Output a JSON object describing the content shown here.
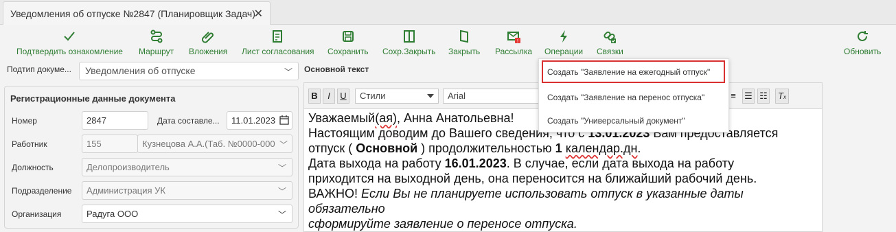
{
  "tab": {
    "title": "Уведомления об отпуске №2847 (Планировщик Задач)"
  },
  "toolbar": {
    "confirm": "Подтвердить ознакомление",
    "route": "Маршрут",
    "attachments": "Вложения",
    "approval_sheet": "Лист согласования",
    "save": "Сохранить",
    "save_close": "Сохр.Закрыть",
    "close": "Закрыть",
    "mailing": "Рассылка",
    "operations": "Операции",
    "links": "Связки",
    "refresh": "Обновить"
  },
  "form": {
    "subtype_label": "Подтип докуме...",
    "subtype_value": "Уведомления об отпуске",
    "reg_title": "Регистрационные данные документа",
    "number_label": "Номер",
    "number_value": "2847",
    "date_label": "Дата составле...",
    "date_value": "11.01.2023",
    "employee_label": "Работник",
    "employee_id": "155",
    "employee_name": "Кузнецова А.А.(Таб. №0000-000",
    "position_label": "Должность",
    "position_value": "Делопроизводитель",
    "department_label": "Подразделение",
    "department_value": "Администрация УК",
    "org_label": "Организация",
    "org_value": "Радуга ООО"
  },
  "editor": {
    "title": "Основной текст",
    "bold": "B",
    "italic": "I",
    "underline": "U",
    "styles": "Стили",
    "font": "Arial",
    "body": {
      "l1_a": "Уважаемый",
      "l1_b": "(ая)",
      "l1_c": ", Анна Анатольевна!",
      "l2_a": "Настоящим доводим до Вашего сведения, что с ",
      "l2_date": "13.01.2023",
      "l2_b": " Вам предоставляется",
      "l3_a": "отпуск ( ",
      "l3_kind": "Основной",
      "l3_b": " ) продолжительностью ",
      "l3_num": "1",
      "l3_c": " ",
      "l3_unit": "календар.дн",
      "l3_d": ".",
      "l4_a": "Дата выхода на работу ",
      "l4_date": "16.01.2023",
      "l4_b": ". В случае, если дата выхода на работу",
      "l5": "приходится на выходной день, она переносится на ближайший рабочий день.",
      "l6_a": "ВАЖНО! ",
      "l6_b": "Если Вы не планируете использовать отпуск в указанные даты обязательно",
      "l7": "сформируйте заявление о переносе отпуска."
    }
  },
  "operations_menu": {
    "items": [
      "Создать \"Заявление на ежегодный отпуск\"",
      "Создать \"Заявление на перенос отпуска\"",
      "Создать \"Универсальный документ\""
    ]
  },
  "colors": {
    "accent_green": "#2e7d32",
    "highlight_red": "#d93030",
    "badge_red": "#e53935"
  }
}
